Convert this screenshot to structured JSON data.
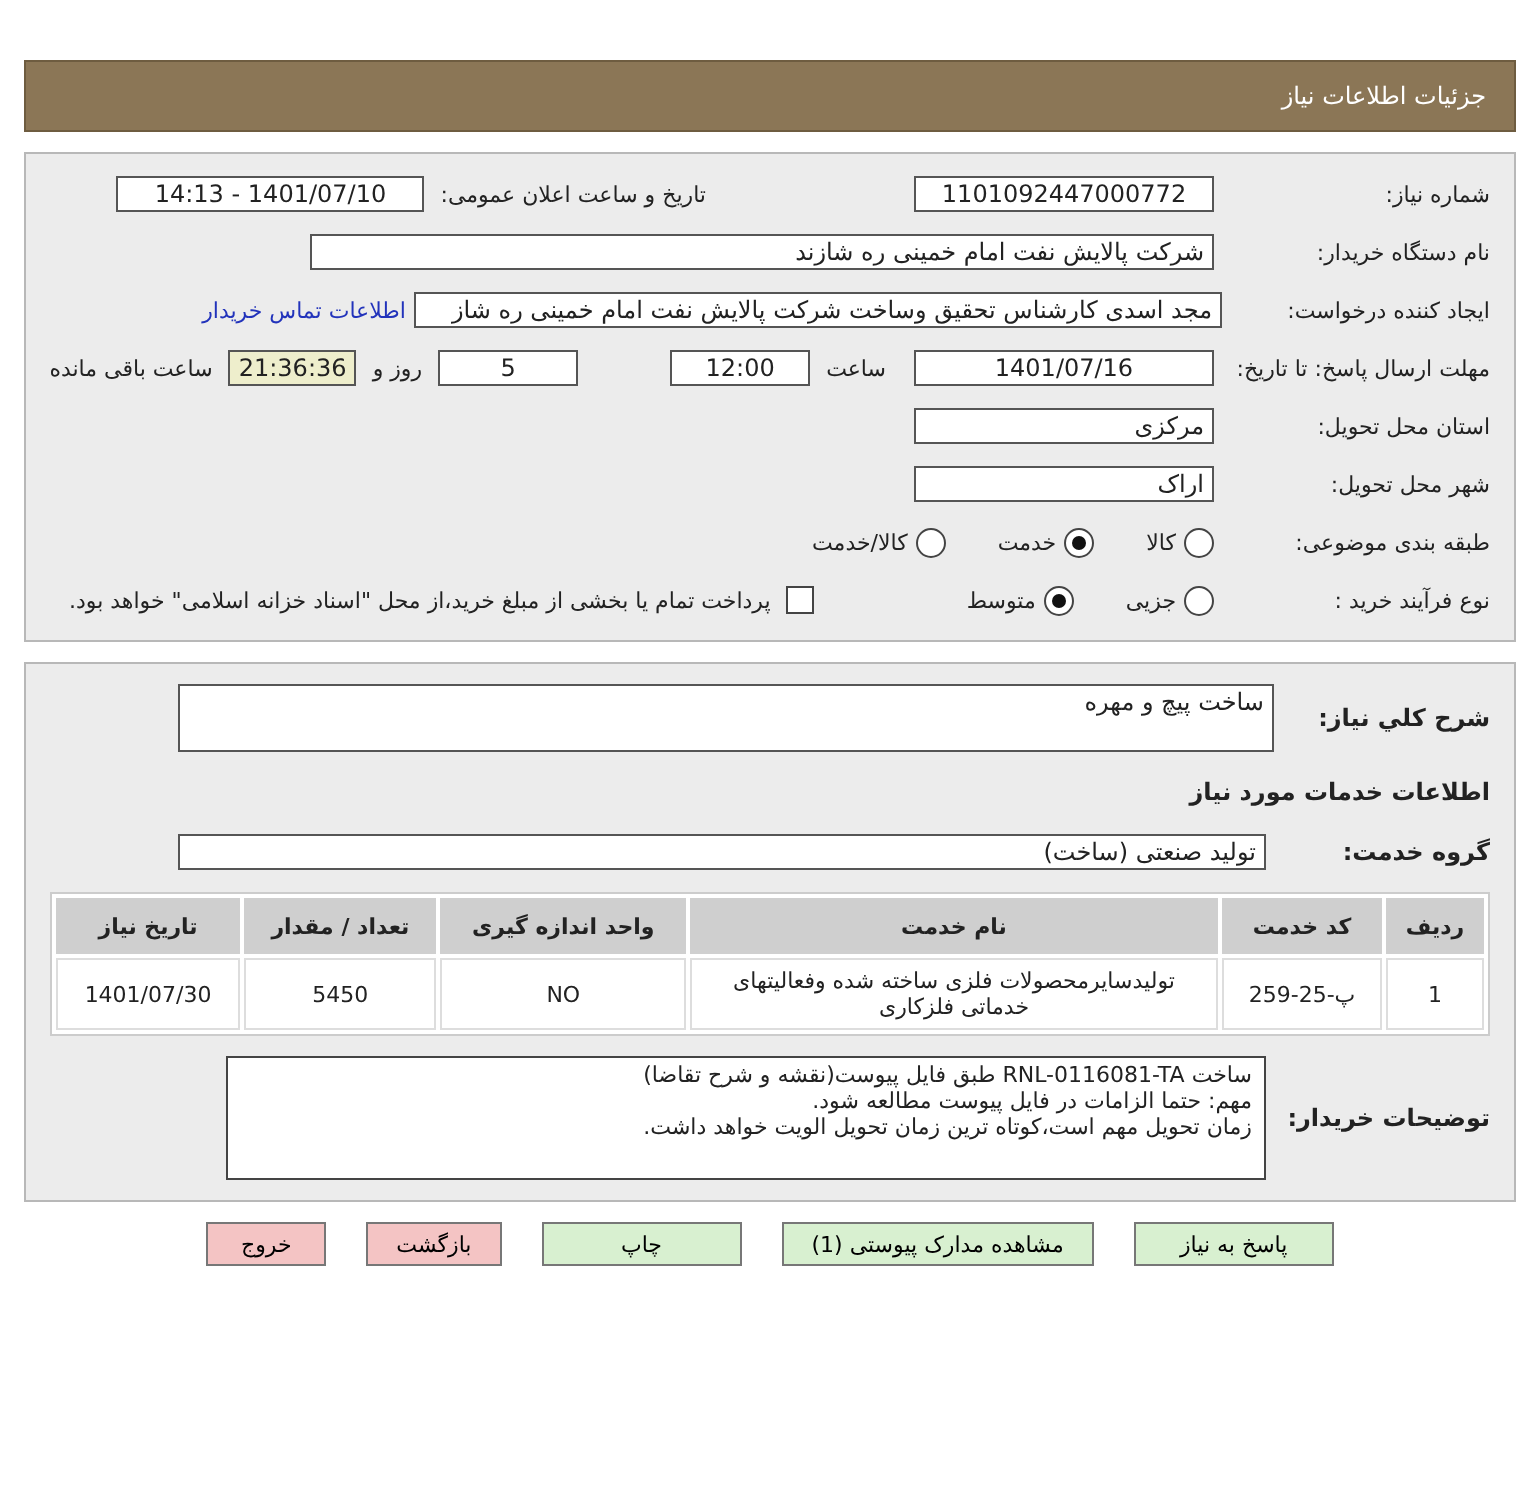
{
  "header": {
    "title": "جزئیات اطلاعات نیاز"
  },
  "need_number": {
    "label": "شماره نیاز:",
    "value": "1101092447000772"
  },
  "announce": {
    "label": "تاریخ و ساعت اعلان عمومی:",
    "value": "1401/07/10 - 14:13"
  },
  "buyer_org": {
    "label": "نام دستگاه خریدار:",
    "value": "شرکت پالایش نفت امام خمینی  ره  شازند"
  },
  "requester": {
    "label": "ایجاد کننده درخواست:",
    "value": "مجد اسدی کارشناس تحقیق وساخت شرکت پالایش نفت امام خمینی  ره  شاز",
    "link": "اطلاعات تماس خریدار"
  },
  "deadline": {
    "label": "مهلت ارسال پاسخ: تا تاریخ:",
    "date": "1401/07/16",
    "time_label": "ساعت",
    "time": "12:00",
    "days": "5",
    "days_label": "روز و",
    "remaining": "21:36:36",
    "remaining_label": "ساعت باقی مانده"
  },
  "province": {
    "label": "استان محل تحویل:",
    "value": "مرکزی"
  },
  "city": {
    "label": "شهر محل تحویل:",
    "value": "اراک"
  },
  "category": {
    "label": "طبقه بندی موضوعی:",
    "options": [
      {
        "label": "کالا",
        "selected": false
      },
      {
        "label": "خدمت",
        "selected": true
      },
      {
        "label": "کالا/خدمت",
        "selected": false
      }
    ]
  },
  "purchase_type": {
    "label": "نوع فرآیند خرید :",
    "options": [
      {
        "label": "جزیی",
        "selected": false
      },
      {
        "label": "متوسط",
        "selected": true
      }
    ],
    "treasury": {
      "checked": false,
      "label": "پرداخت تمام یا بخشی از مبلغ خرید،از محل \"اسناد خزانه اسلامی\" خواهد بود."
    }
  },
  "summary": {
    "label": "شرح کلي نياز:",
    "value": "ساخت پیچ و مهره"
  },
  "services_heading": "اطلاعات خدمات مورد نیاز",
  "service_group": {
    "label": "گروه خدمت:",
    "value": "تولید صنعتی (ساخت)"
  },
  "table": {
    "columns": [
      "ردیف",
      "کد خدمت",
      "نام خدمت",
      "واحد اندازه گیری",
      "تعداد / مقدار",
      "تاریخ نیاز"
    ],
    "rows": [
      [
        "1",
        "پ-25-259",
        "تولیدسایرمحصولات فلزی ساخته شده وفعالیتهای خدماتی فلزکاری",
        "NO",
        "5450",
        "1401/07/30"
      ]
    ]
  },
  "buyer_notes": {
    "label": "توضیحات خریدار:",
    "lines": [
      "ساخت RNL-0116081-TA طبق فایل پیوست(نقشه و شرح تقاضا)",
      "مهم: حتما الزامات در فایل پیوست مطالعه شود.",
      "زمان تحویل مهم است،کوتاه ترین زمان تحویل الویت خواهد داشت."
    ]
  },
  "buttons": [
    {
      "label": "پاسخ به نیاز",
      "kind": "normal"
    },
    {
      "label": "مشاهده مدارک پیوستی (1)",
      "kind": "normal"
    },
    {
      "label": "چاپ",
      "kind": "normal"
    },
    {
      "label": "بازگشت",
      "kind": "danger"
    },
    {
      "label": "خروج",
      "kind": "danger"
    }
  ]
}
